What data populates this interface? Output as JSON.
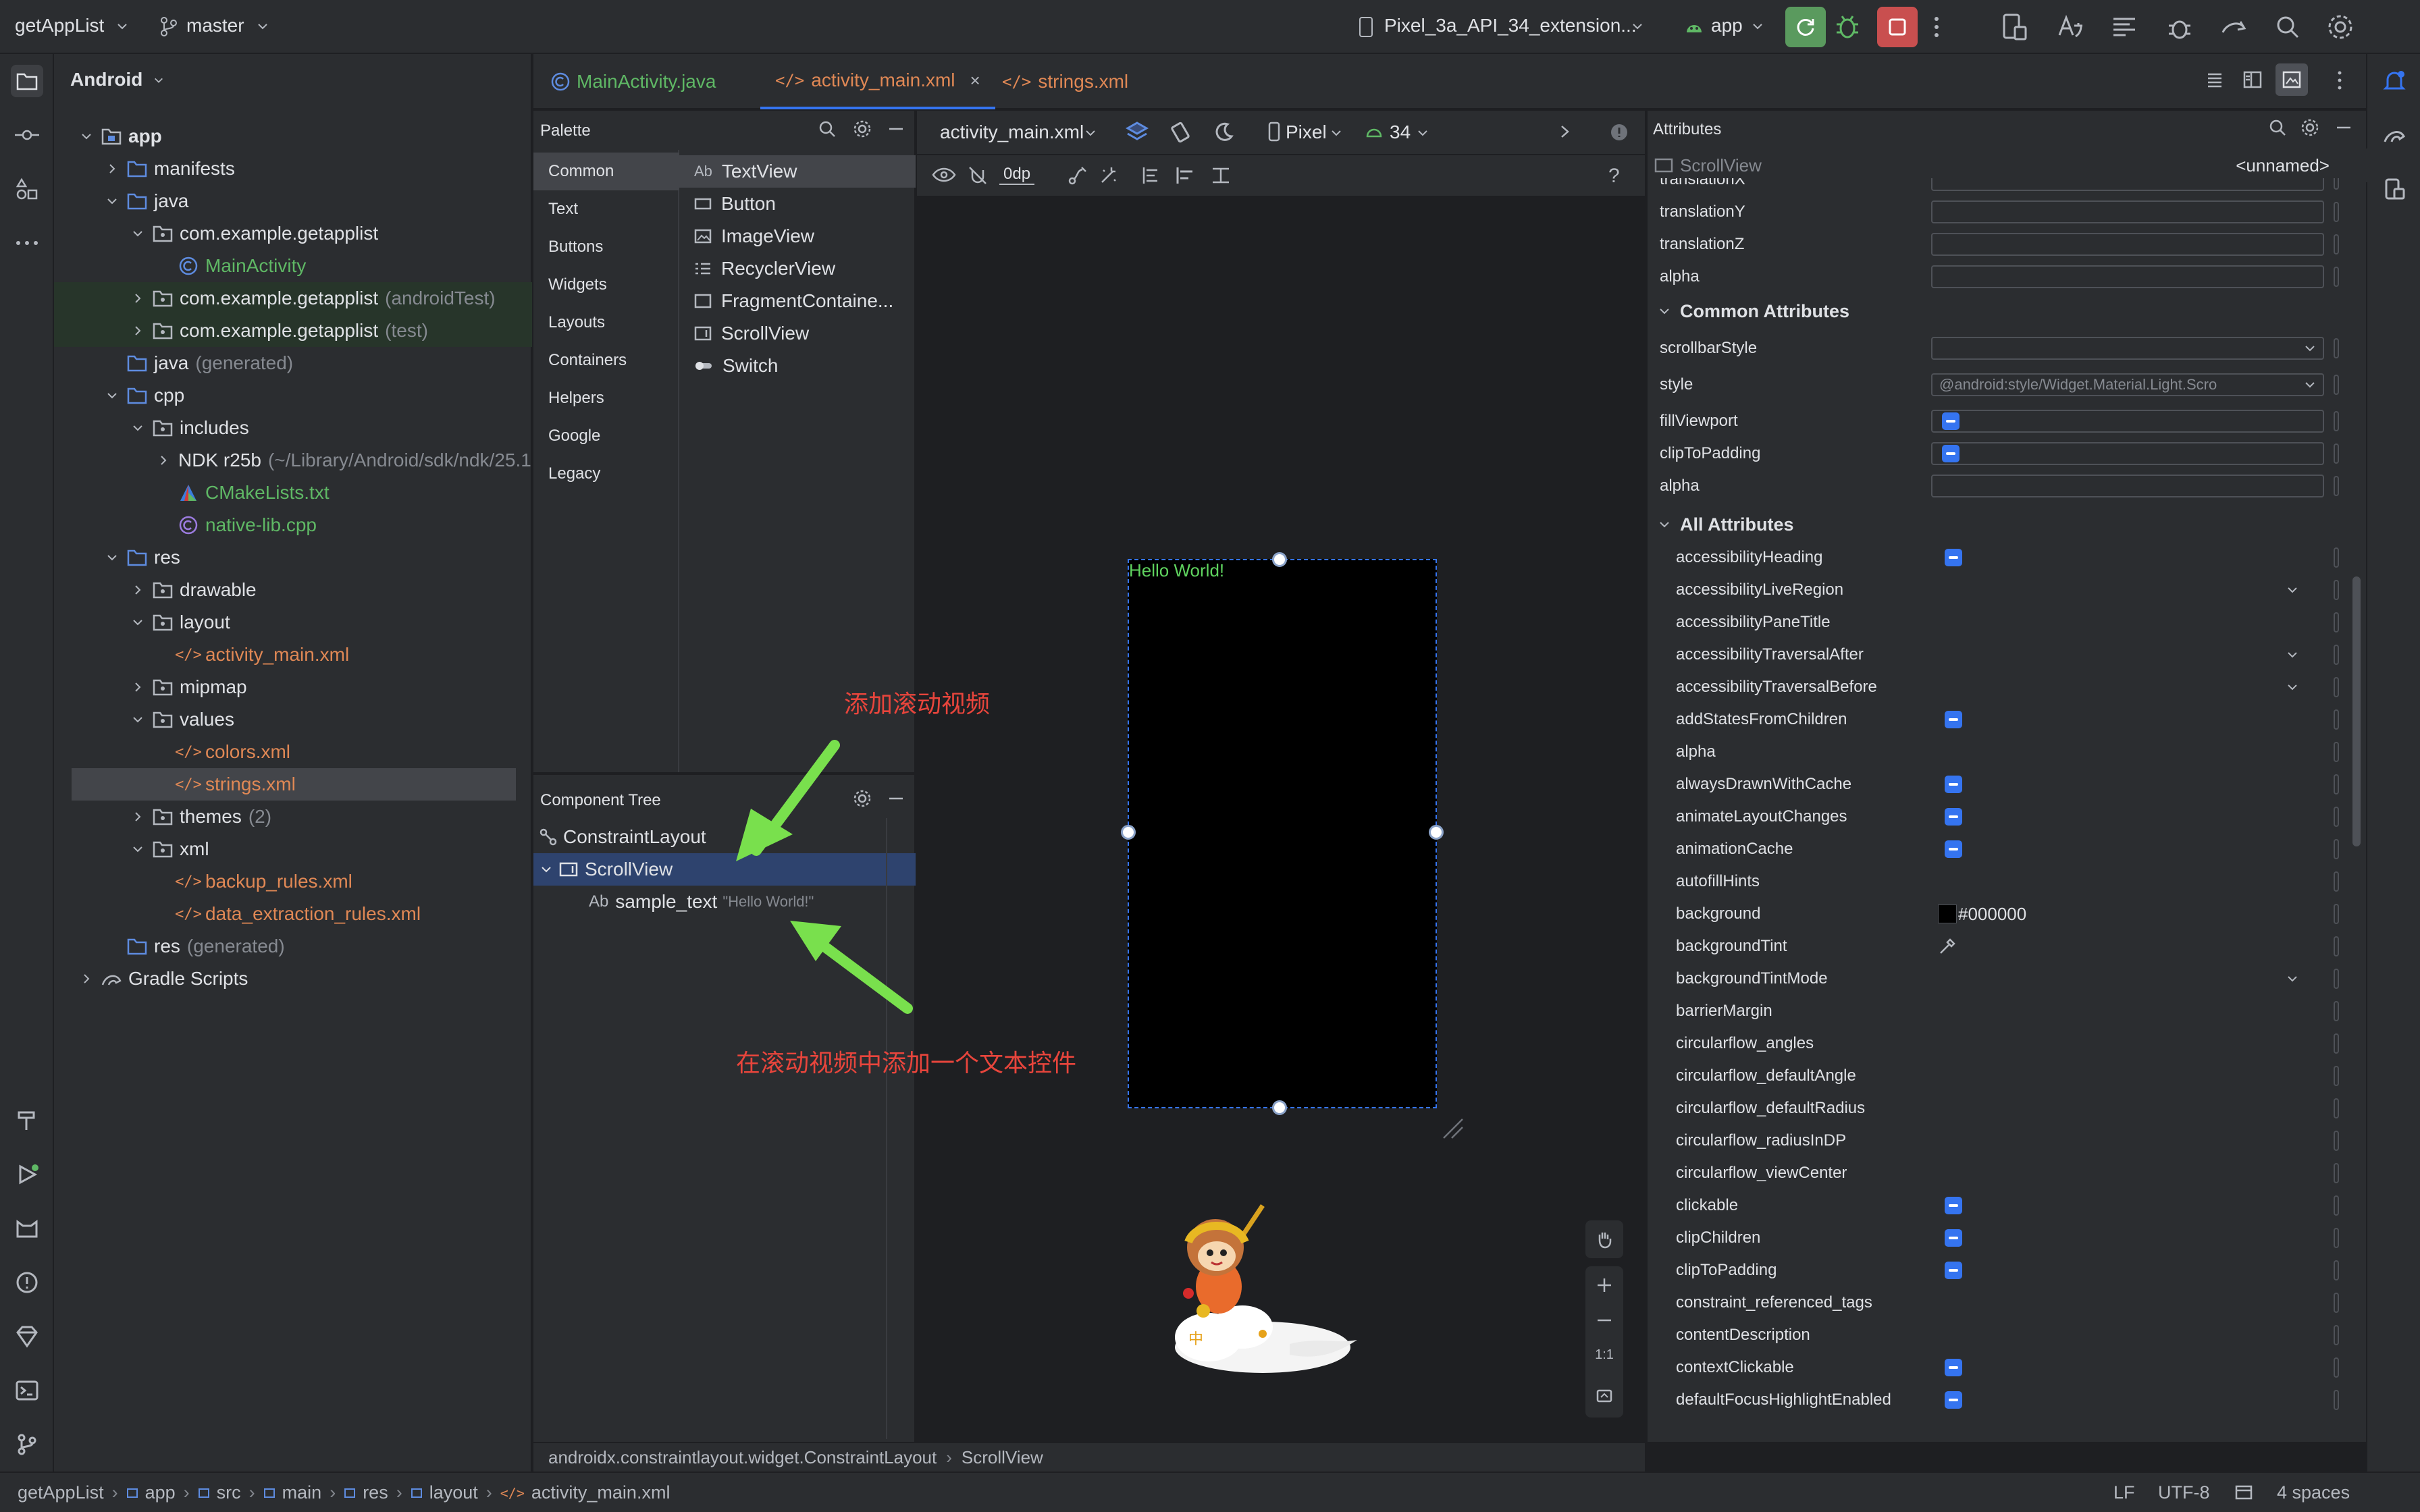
{
  "titlebar": {
    "project": "getAppList",
    "branch": "master",
    "device": "Pixel_3a_API_34_extension...",
    "run_config": "app"
  },
  "project_panel": {
    "view": "Android",
    "tree": [
      {
        "label": "app",
        "suffix": ""
      },
      {
        "label": "manifests",
        "suffix": ""
      },
      {
        "label": "java",
        "suffix": ""
      },
      {
        "label": "com.example.getapplist",
        "suffix": ""
      },
      {
        "label": "MainActivity",
        "suffix": ""
      },
      {
        "label": "com.example.getapplist",
        "suffix": "(androidTest)"
      },
      {
        "label": "com.example.getapplist",
        "suffix": "(test)"
      },
      {
        "label": "java",
        "suffix": "(generated)"
      },
      {
        "label": "cpp",
        "suffix": ""
      },
      {
        "label": "includes",
        "suffix": ""
      },
      {
        "label": "NDK r25b",
        "suffix": "(~/Library/Android/sdk/ndk/25.1"
      },
      {
        "label": "CMakeLists.txt",
        "suffix": ""
      },
      {
        "label": "native-lib.cpp",
        "suffix": ""
      },
      {
        "label": "res",
        "suffix": ""
      },
      {
        "label": "drawable",
        "suffix": ""
      },
      {
        "label": "layout",
        "suffix": ""
      },
      {
        "label": "activity_main.xml",
        "suffix": ""
      },
      {
        "label": "mipmap",
        "suffix": ""
      },
      {
        "label": "values",
        "suffix": ""
      },
      {
        "label": "colors.xml",
        "suffix": ""
      },
      {
        "label": "strings.xml",
        "suffix": ""
      },
      {
        "label": "themes",
        "suffix": "(2)"
      },
      {
        "label": "xml",
        "suffix": ""
      },
      {
        "label": "backup_rules.xml",
        "suffix": ""
      },
      {
        "label": "data_extraction_rules.xml",
        "suffix": ""
      },
      {
        "label": "res",
        "suffix": "(generated)"
      },
      {
        "label": "Gradle Scripts",
        "suffix": ""
      }
    ]
  },
  "tabs": [
    "MainActivity.java",
    "activity_main.xml",
    "strings.xml"
  ],
  "palette": {
    "title": "Palette",
    "categories": [
      "Common",
      "Text",
      "Buttons",
      "Widgets",
      "Layouts",
      "Containers",
      "Helpers",
      "Google",
      "Legacy"
    ],
    "items": [
      "TextView",
      "Button",
      "ImageView",
      "RecyclerView",
      "FragmentContaine...",
      "ScrollView",
      "Switch"
    ]
  },
  "component_tree": {
    "title": "Component Tree",
    "root": "ConstraintLayout",
    "child": "ScrollView",
    "grandchild": "sample_text",
    "grandchild_value": "\"Hello World!\""
  },
  "design": {
    "file": "activity_main.xml",
    "device": "Pixel",
    "api": "34",
    "margin": "0dp",
    "preview_text": "Hello World!",
    "zoom_fit": "1:1"
  },
  "annotations": {
    "top": "添加滚动视频",
    "bottom": "在滚动视频中添加一个文本控件"
  },
  "attributes": {
    "title": "Attributes",
    "component": "ScrollView",
    "id": "<unnamed>",
    "partial_top": "translationX",
    "top_rows": [
      "translationY",
      "translationZ",
      "alpha"
    ],
    "common_section": "Common Attributes",
    "common": [
      {
        "name": "scrollbarStyle",
        "value": ""
      },
      {
        "name": "style",
        "value": "@android:style/Widget.Material.Light.Scro"
      },
      {
        "name": "fillViewport",
        "value": ""
      },
      {
        "name": "clipToPadding",
        "value": ""
      },
      {
        "name": "alpha",
        "value": ""
      }
    ],
    "all_section": "All Attributes",
    "all": [
      {
        "name": "accessibilityHeading",
        "kind": "check"
      },
      {
        "name": "accessibilityLiveRegion",
        "kind": "dropdown"
      },
      {
        "name": "accessibilityPaneTitle",
        "kind": "text"
      },
      {
        "name": "accessibilityTraversalAfter",
        "kind": "dropdown"
      },
      {
        "name": "accessibilityTraversalBefore",
        "kind": "dropdown"
      },
      {
        "name": "addStatesFromChildren",
        "kind": "check"
      },
      {
        "name": "alpha",
        "kind": "text"
      },
      {
        "name": "alwaysDrawnWithCache",
        "kind": "check"
      },
      {
        "name": "animateLayoutChanges",
        "kind": "check"
      },
      {
        "name": "animationCache",
        "kind": "check"
      },
      {
        "name": "autofillHints",
        "kind": "text"
      },
      {
        "name": "background",
        "kind": "color"
      },
      {
        "name": "backgroundTint",
        "kind": "picker"
      },
      {
        "name": "backgroundTintMode",
        "kind": "dropdown"
      },
      {
        "name": "barrierMargin",
        "kind": "text"
      },
      {
        "name": "circularflow_angles",
        "kind": "text"
      },
      {
        "name": "circularflow_defaultAngle",
        "kind": "text"
      },
      {
        "name": "circularflow_defaultRadius",
        "kind": "text"
      },
      {
        "name": "circularflow_radiusInDP",
        "kind": "text"
      },
      {
        "name": "circularflow_viewCenter",
        "kind": "text"
      },
      {
        "name": "clickable",
        "kind": "check"
      },
      {
        "name": "clipChildren",
        "kind": "check"
      },
      {
        "name": "clipToPadding",
        "kind": "check"
      },
      {
        "name": "constraint_referenced_tags",
        "kind": "text"
      },
      {
        "name": "contentDescription",
        "kind": "text"
      },
      {
        "name": "contextClickable",
        "kind": "check"
      },
      {
        "name": "defaultFocusHighlightEnabled",
        "kind": "check"
      }
    ],
    "background_value": "#000000",
    "colors": {
      "accent": "#3574f0",
      "background": "#000000"
    }
  },
  "breadcrumb": [
    "androidx.constraintlayout.widget.ConstraintLayout",
    "ScrollView"
  ],
  "status": {
    "path": [
      "getAppList",
      "app",
      "src",
      "main",
      "res",
      "layout",
      "activity_main.xml"
    ],
    "line_sep": "LF",
    "encoding": "UTF-8",
    "indent": "4 spaces"
  }
}
